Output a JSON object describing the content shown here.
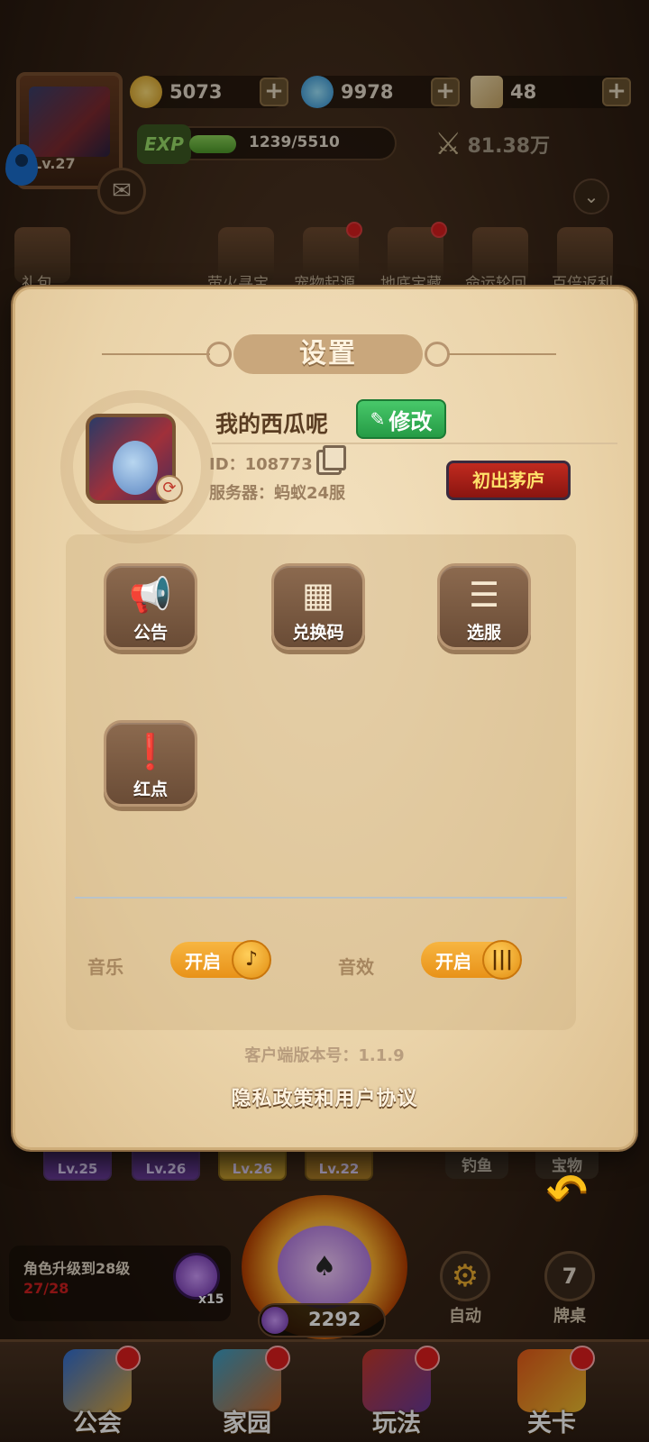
{
  "hud": {
    "player_level": "Lv.27",
    "gold": "5073",
    "diamonds": "9978",
    "tickets": "48",
    "exp_badge": "EXP",
    "exp_text": "1239/5510",
    "exp_fraction": 0.225,
    "power": "81.38万"
  },
  "activities": [
    {
      "label": "礼包"
    },
    {
      "label": "萤火寻宝"
    },
    {
      "label": "宠物起源"
    },
    {
      "label": "地底宝藏"
    },
    {
      "label": "命运轮回"
    },
    {
      "label": "百倍返利"
    }
  ],
  "settings": {
    "title": "设置",
    "name": "我的西瓜呢",
    "edit_label": "修改",
    "id_text": "ID：108773",
    "server_text": "服务器：蚂蚁24服",
    "rank_badge": "初出茅庐",
    "features": [
      {
        "label": "公告",
        "icon": "megaphone-icon"
      },
      {
        "label": "兑换码",
        "icon": "qr-code-icon"
      },
      {
        "label": "选服",
        "icon": "checklist-icon"
      },
      {
        "label": "红点",
        "icon": "exclamation-icon"
      }
    ],
    "music_label": "音乐",
    "music_toggle": "开启",
    "sfx_label": "音效",
    "sfx_toggle": "开启",
    "version": "客户端版本号：1.1.9",
    "privacy": "隐私政策和用户协议"
  },
  "bottom": {
    "heroes": [
      {
        "level": "Lv.25"
      },
      {
        "level": "Lv.26"
      },
      {
        "level": "Lv.26"
      },
      {
        "level": "Lv.22"
      }
    ],
    "fishing_label": "钓鱼",
    "treasure_label": "宝物",
    "quest_text": "角色升级到28级",
    "quest_progress": "27/28",
    "quest_chip_count": "x15",
    "chips": "2292",
    "auto_label": "自动",
    "table_label": "牌桌",
    "table_number": "7"
  },
  "nav": [
    {
      "label": "公会"
    },
    {
      "label": "家园"
    },
    {
      "label": "玩法"
    },
    {
      "label": "关卡"
    }
  ],
  "colors": {
    "panel": "#ead3a9",
    "accent_green": "#2fae52",
    "toggle_orange": "#f0a030",
    "badge_red": "#b0221a"
  }
}
